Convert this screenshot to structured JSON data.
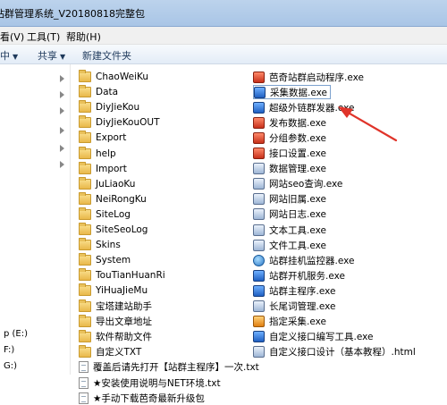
{
  "window": {
    "title": "站群管理系统_V20180818完整包"
  },
  "menu": {
    "view": "看(V)",
    "tools": "工具(T)",
    "help": "帮助(H)"
  },
  "toolbar": {
    "organize": "中",
    "share": "共享",
    "new_folder": "新建文件夹"
  },
  "nav": {
    "drives": [
      "p (E:)",
      "F:)",
      "G:)"
    ]
  },
  "files_left": [
    {
      "name": "ChaoWeiKu",
      "type": "folder"
    },
    {
      "name": "Data",
      "type": "folder"
    },
    {
      "name": "DiyJieKou",
      "type": "folder"
    },
    {
      "name": "DiyJieKouOUT",
      "type": "folder"
    },
    {
      "name": "Export",
      "type": "folder"
    },
    {
      "name": "help",
      "type": "folder"
    },
    {
      "name": "Import",
      "type": "folder"
    },
    {
      "name": "JuLiaoKu",
      "type": "folder"
    },
    {
      "name": "NeiRongKu",
      "type": "folder"
    },
    {
      "name": "SiteLog",
      "type": "folder"
    },
    {
      "name": "SiteSeoLog",
      "type": "folder"
    },
    {
      "name": "Skins",
      "type": "folder"
    },
    {
      "name": "System",
      "type": "folder"
    },
    {
      "name": "TouTianHuanRi",
      "type": "folder"
    },
    {
      "name": "YiHuaJieMu",
      "type": "folder"
    },
    {
      "name": "宝塔建站助手",
      "type": "folder"
    },
    {
      "name": "导出文章地址",
      "type": "folder"
    },
    {
      "name": "软件帮助文件",
      "type": "folder"
    },
    {
      "name": "自定义TXT",
      "type": "folder"
    },
    {
      "name": "覆盖后请先打开【站群主程序】一次.txt",
      "type": "txt"
    },
    {
      "name": "★安装使用说明与NET环境.txt",
      "type": "txt"
    },
    {
      "name": "★手动下载芭奇最新升级包",
      "type": "txt"
    }
  ],
  "files_right": [
    {
      "name": "芭奇站群启动程序.exe",
      "icon": "red"
    },
    {
      "name": "采集数据.exe",
      "icon": "blue",
      "selected": true
    },
    {
      "name": "超级外链群发器.exe",
      "icon": "blue"
    },
    {
      "name": "发布数据.exe",
      "icon": "red"
    },
    {
      "name": "分组参数.exe",
      "icon": "red"
    },
    {
      "name": "接口设置.exe",
      "icon": "red"
    },
    {
      "name": "数据管理.exe",
      "icon": "default"
    },
    {
      "name": "网站seo查询.exe",
      "icon": "default"
    },
    {
      "name": "网站旧属.exe",
      "icon": "default"
    },
    {
      "name": "网站日志.exe",
      "icon": "default"
    },
    {
      "name": "文本工具.exe",
      "icon": "default"
    },
    {
      "name": "文件工具.exe",
      "icon": "default"
    },
    {
      "name": "站群挂机监控器.exe",
      "icon": "globe"
    },
    {
      "name": "站群开机服务.exe",
      "icon": "blue"
    },
    {
      "name": "站群主程序.exe",
      "icon": "blue"
    },
    {
      "name": "长尾词管理.exe",
      "icon": "default"
    },
    {
      "name": "指定采集.exe",
      "icon": "orange"
    },
    {
      "name": "自定义接口编写工具.exe",
      "icon": "blue"
    },
    {
      "name": "自定义接口设计（基本教程）.html",
      "icon": "default"
    }
  ]
}
